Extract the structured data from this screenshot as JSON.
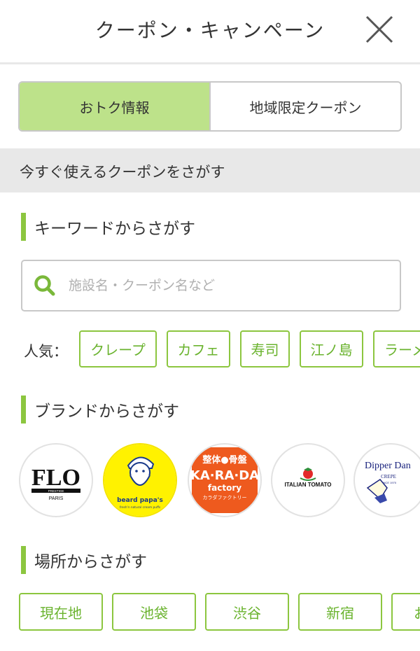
{
  "header": {
    "title": "クーポン・キャンペーン",
    "close_icon": "close-icon"
  },
  "tabs": [
    {
      "label": "おトク情報",
      "active": true
    },
    {
      "label": "地域限定クーポン",
      "active": false
    }
  ],
  "section": {
    "title": "今すぐ使えるクーポンをさがす"
  },
  "keyword": {
    "heading": "キーワードからさがす",
    "search_placeholder": "施設名・クーポン名など",
    "search_value": "",
    "popular_label": "人気：",
    "popular_tags": [
      "クレープ",
      "カフェ",
      "寿司",
      "江ノ島",
      "ラーメン"
    ]
  },
  "brand": {
    "heading": "ブランドからさがす",
    "items": [
      {
        "name": "FLO",
        "sub": "PRESTIGE",
        "city": "PARIS"
      },
      {
        "name": "beard papa's",
        "tagline": "fresh'n natural cream puffs"
      },
      {
        "name_top": "整体●骨盤",
        "name": "KA·RA·DA",
        "sub": "factory",
        "kana": "カラダファクトリー"
      },
      {
        "name": "ITALIAN TOMATO"
      },
      {
        "name": "Dipper Dan",
        "sub": "CREPE",
        "since": "SINCE 1970"
      }
    ]
  },
  "location": {
    "heading": "場所からさがす",
    "items": [
      "現在地",
      "池袋",
      "渋谷",
      "新宿",
      "お"
    ]
  },
  "colors": {
    "accent": "#8cc63f",
    "accent_text": "#6ab32e",
    "active_tab": "#bde28a",
    "section_bg": "#e8e8e8"
  }
}
